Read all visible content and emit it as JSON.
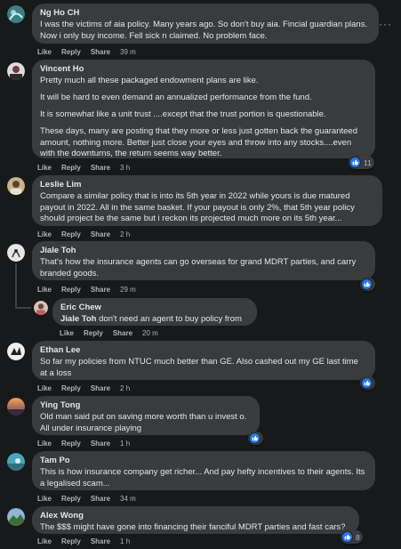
{
  "comments": [
    {
      "name": "Ng Ho CH",
      "paragraphs": [
        "I was the victims of aia policy. Many years ago. So don't buy aia. Fincial guardian plans. Now i only buy income. Fell sick n claimed. No problem face."
      ],
      "actions": {
        "like": "Like",
        "reply": "Reply",
        "share": "Share",
        "time": "39 m"
      }
    },
    {
      "name": "Vincent Ho",
      "paragraphs": [
        "Pretty much all these packaged endowment plans are like.",
        "It will be hard to even demand an annualized performance from the fund.",
        "It is somewhat like a unit trust ....except that the trust portion is questionable.",
        "These days, many are posting that they more or less just gotten back the guaranteed amount, nothing more. Better just close your eyes and throw into any stocks....even with the downturns, the return seems way better."
      ],
      "actions": {
        "like": "Like",
        "reply": "Reply",
        "share": "Share",
        "time": "3 h"
      },
      "reactions": "11"
    },
    {
      "name": "Leslie Lim",
      "paragraphs": [
        "Compare a similar policy that is into its 5th year in 2022 while yours is due matured payout in 2022. All in the same basket. If your payout is only 2%, that 5th year policy should project be the same but i reckon its projected much more on its 5th year..."
      ],
      "actions": {
        "like": "Like",
        "reply": "Reply",
        "share": "Share",
        "time": "2 h"
      }
    },
    {
      "name": "Jiale Toh",
      "paragraphs": [
        "That's how the insurance agents can go overseas for grand MDRT parties, and carry branded goods."
      ],
      "actions": {
        "like": "Like",
        "reply": "Reply",
        "share": "Share",
        "time": "29 m"
      }
    },
    {
      "name": "Eric Chew",
      "mention": "Jiale Toh",
      "paragraphs": [
        "don't need an agent to buy policy from"
      ],
      "actions": {
        "like": "Like",
        "reply": "Reply",
        "share": "Share",
        "time": "20 m"
      }
    },
    {
      "name": "Ethan Lee",
      "paragraphs": [
        "So far my policies from NTUC much better than GE. Also cashed out my GE last time at a loss"
      ],
      "actions": {
        "like": "Like",
        "reply": "Reply",
        "share": "Share",
        "time": "2 h"
      }
    },
    {
      "name": "Ying Tong",
      "paragraphs": [
        "Old man said put on saving more worth than u invest o.",
        "All under insurance playing"
      ],
      "actions": {
        "like": "Like",
        "reply": "Reply",
        "share": "Share",
        "time": "1 h"
      }
    },
    {
      "name": "Tam Po",
      "paragraphs": [
        "This is how insurance company get richer... And pay hefty incentives to their agents. Its a legalised scam..."
      ],
      "actions": {
        "like": "Like",
        "reply": "Reply",
        "share": "Share",
        "time": "34 m"
      }
    },
    {
      "name": "Alex Wong",
      "paragraphs": [
        "The $$$ might have gone into financing their fanciful MDRT parties and fast cars?"
      ],
      "actions": {
        "like": "Like",
        "reply": "Reply",
        "share": "Share",
        "time": "1 h"
      },
      "reactions": "8"
    }
  ],
  "more_menu": "···",
  "colors": {
    "bubble": "#3a3b3c",
    "background": "#18191a",
    "like_blue": "#2078f4"
  }
}
